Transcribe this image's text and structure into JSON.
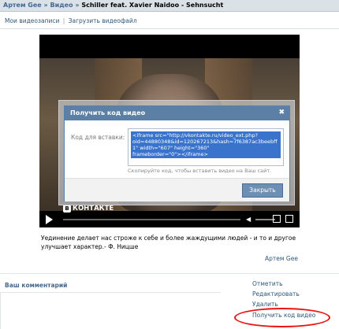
{
  "breadcrumb": {
    "user": "Артем Gee",
    "section": "Видео",
    "separator": "»",
    "current": "Schiller feat. Xavier Naidoo - Sehnsucht"
  },
  "subnav": {
    "my_videos": "Мои видеозаписи",
    "separator": "|",
    "upload": "Загрузить видеофайл"
  },
  "player": {
    "logo_letter": "В",
    "logo_text": "КОНТАКТЕ",
    "play_icon": "play-icon",
    "volume_icon": "speaker-icon"
  },
  "dialog": {
    "title": "Получить код видео",
    "close": "✖",
    "code_label": "Код для вставки:",
    "code_value": "<iframe src=\"http://vkontakte.ru/video_ext.php?\noid=44880348&id=120267213&hash=7f6387ac3beebff\n1\" width=\"607\" height=\"360\"\nframeborder=\"0\"></iframe>",
    "hint": "Скопируйте код, чтобы вставить видео на Ваш сайт.",
    "close_button": "Закрыть"
  },
  "description": "Уединение делает нас строже к себе и более жаждущими людей - и то и другое улучшает характер.- Ф. Ницше",
  "author": "Артем Gee",
  "comments": {
    "title": "Ваш комментарий"
  },
  "actions": [
    {
      "label": "Отметить"
    },
    {
      "label": "Редактировать"
    },
    {
      "label": "Удалить"
    },
    {
      "label": "Получить код видео"
    }
  ],
  "colors": {
    "accent": "#5c7fa6",
    "link": "#2b587a",
    "highlight_oval": "#e11111"
  }
}
